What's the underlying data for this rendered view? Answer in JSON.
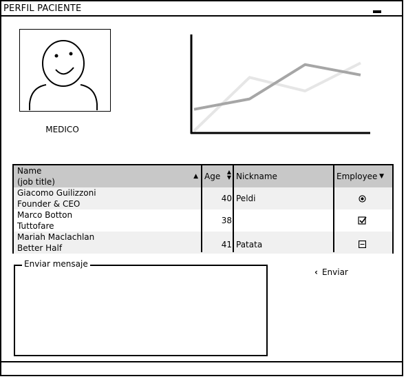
{
  "window": {
    "title": "PERFIL PACIENTE"
  },
  "profile": {
    "role_label": "MEDICO"
  },
  "chart_data": {
    "type": "line",
    "title": "",
    "xlabel": "",
    "ylabel": "",
    "x": [
      1,
      2,
      3,
      4
    ],
    "series": [
      {
        "color": "#e6e6e6",
        "values": [
          0,
          67,
          50,
          85
        ]
      },
      {
        "color": "#a6a6a6",
        "values": [
          27,
          40,
          83,
          70
        ]
      }
    ],
    "ylim": [
      0,
      100
    ],
    "grid": false
  },
  "table": {
    "headers": {
      "name_line1": "Name",
      "name_line2": "(job title)",
      "age": "Age",
      "nickname": "Nickname",
      "employee": "Employee"
    },
    "rows": [
      {
        "name": "Giacomo Guilizzoni",
        "title": "Founder & CEO",
        "age": "40",
        "nickname": "Peldi",
        "employee_icon": "radio-selected-icon"
      },
      {
        "name": "Marco Botton",
        "title": "Tuttofare",
        "age": "38",
        "nickname": "",
        "employee_icon": "checkbox-checked-icon"
      },
      {
        "name": "Mariah Maclachlan",
        "title": "Better Half",
        "age": "41",
        "nickname": "Patata",
        "employee_icon": "collapse-box-icon"
      }
    ]
  },
  "message": {
    "label": "Enviar mensaje",
    "value": ""
  },
  "send_button": {
    "label": "Enviar",
    "icon": "chevron-left-icon"
  }
}
